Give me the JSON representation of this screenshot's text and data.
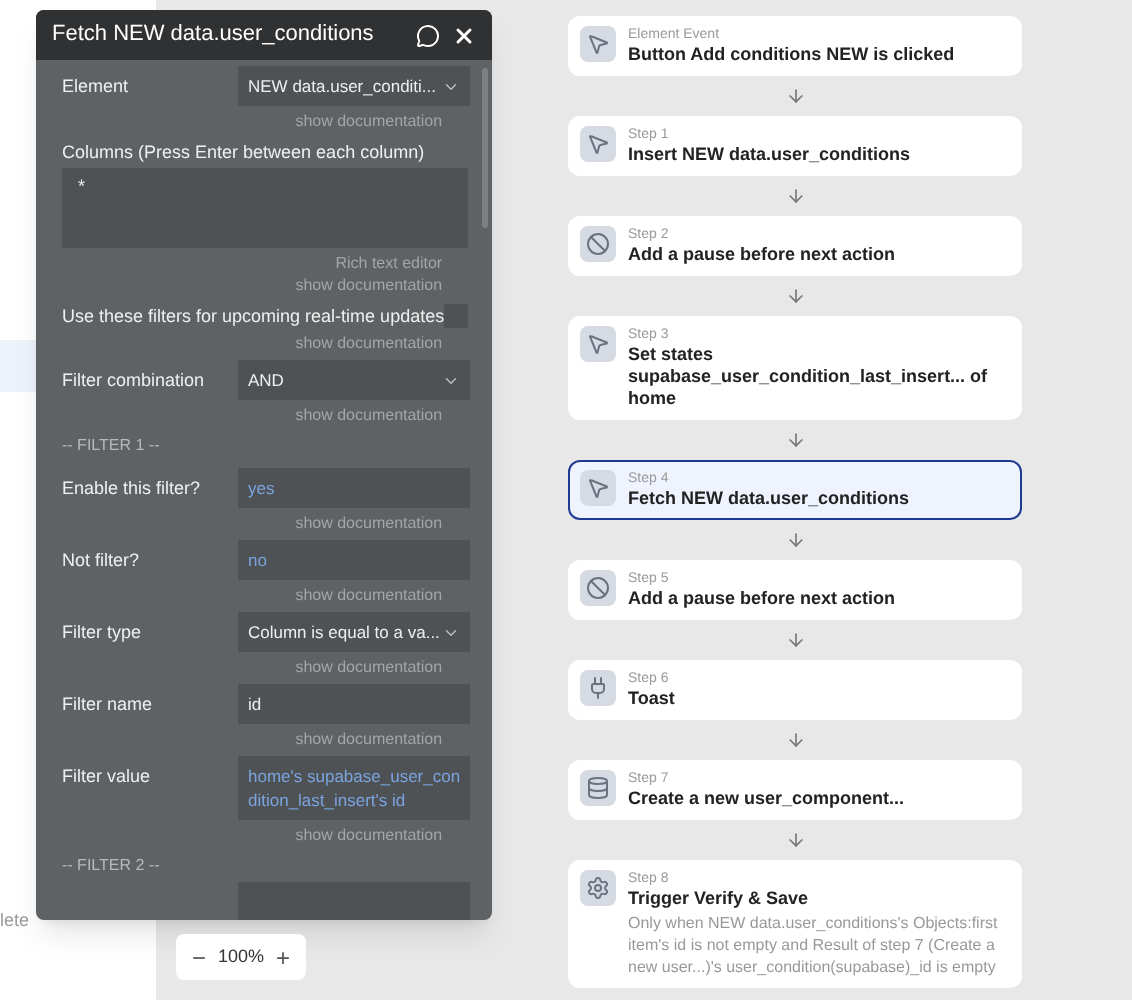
{
  "background_text": "lete",
  "panel": {
    "title": "Fetch NEW data.user_conditions",
    "rows": [
      {
        "kind": "select",
        "label": "Element",
        "value": "NEW data.user_conditi...",
        "doc": [
          "show documentation"
        ]
      },
      {
        "kind": "textarea",
        "label": "Columns (Press Enter between each column)",
        "value": "*",
        "doc": [
          "Rich text editor",
          "show documentation"
        ]
      },
      {
        "kind": "checkbox",
        "label": "Use these filters for upcoming real-time updates",
        "checked": false,
        "doc": [
          "show documentation"
        ]
      },
      {
        "kind": "select",
        "label": "Filter combination",
        "value": "AND",
        "doc": [
          "show documentation"
        ]
      },
      {
        "kind": "heading",
        "label": "-- FILTER 1 --"
      },
      {
        "kind": "dynamic",
        "label": "Enable this filter?",
        "value": "yes",
        "doc": [
          "show documentation"
        ]
      },
      {
        "kind": "dynamic",
        "label": "Not filter?",
        "value": "no",
        "doc": [
          "show documentation"
        ]
      },
      {
        "kind": "select",
        "label": "Filter type",
        "value": "Column is equal to a va...",
        "doc": [
          "show documentation"
        ]
      },
      {
        "kind": "text",
        "label": "Filter name",
        "value": "id",
        "doc": [
          "show documentation"
        ]
      },
      {
        "kind": "dynamic",
        "label": "Filter value",
        "value": " home's supabase_user_condition_last_insert's id",
        "doc": [
          "show documentation"
        ]
      },
      {
        "kind": "heading",
        "label": "-- FILTER 2 --"
      }
    ]
  },
  "zoom": {
    "minus": "−",
    "value": "100%",
    "plus": "+"
  },
  "workflow": [
    {
      "kind": "event",
      "caption": "Element Event",
      "title": "Button Add conditions NEW is clicked",
      "selected": false
    },
    {
      "kind": "cursor",
      "caption": "Step 1",
      "title": "Insert NEW data.user_conditions",
      "selected": false
    },
    {
      "kind": "pause",
      "caption": "Step 2",
      "title": "Add a pause before next action",
      "selected": false
    },
    {
      "kind": "cursor",
      "caption": "Step 3",
      "title": "Set states supabase_user_condition_last_insert... of home",
      "selected": false
    },
    {
      "kind": "cursor",
      "caption": "Step 4",
      "title": "Fetch NEW data.user_conditions",
      "selected": true
    },
    {
      "kind": "pause",
      "caption": "Step 5",
      "title": "Add a pause before next action",
      "selected": false
    },
    {
      "kind": "plug",
      "caption": "Step 6",
      "title": "Toast",
      "selected": false
    },
    {
      "kind": "database",
      "caption": "Step 7",
      "title": "Create a new user_component...",
      "selected": false
    },
    {
      "kind": "gear",
      "caption": "Step 8",
      "title": "Trigger Verify & Save",
      "condition": "Only when NEW data.user_conditions's Objects:first item's id is not empty and Result of step 7 (Create a new user...)'s user_condition(supabase)_id is empty",
      "selected": false
    }
  ]
}
